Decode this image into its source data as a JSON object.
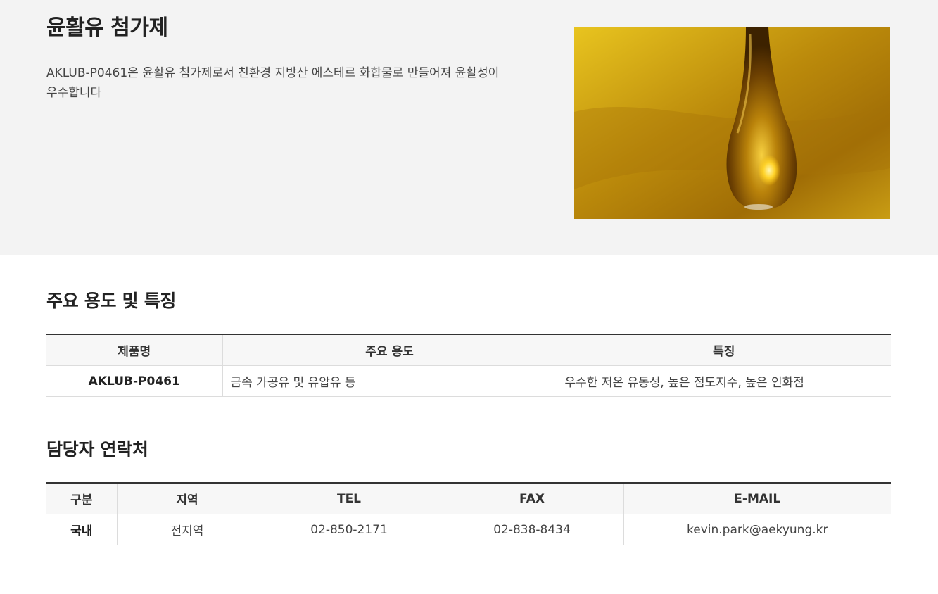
{
  "hero": {
    "title": "윤활유 첨가제",
    "description": "AKLUB-P0461은 윤활유 첨가제로서 친환경 지방산 에스테르 화합물로 만들어져 윤활성이 우수합니다"
  },
  "uses_section": {
    "title": "주요 용도 및 특징",
    "headers": [
      "제품명",
      "주요 용도",
      "특징"
    ],
    "rows": [
      {
        "product": "AKLUB-P0461",
        "use": "금속 가공유 및 유압유 등",
        "feature": "우수한 저온 유동성, 높은 점도지수, 높은 인화점"
      }
    ]
  },
  "contact_section": {
    "title": "담당자 연락처",
    "headers": [
      "구분",
      "지역",
      "TEL",
      "FAX",
      "E-MAIL"
    ],
    "rows": [
      {
        "category": "국내",
        "region": "전지역",
        "tel": "02-850-2171",
        "fax": "02-838-8434",
        "email": "kevin.park@aekyung.kr"
      }
    ]
  },
  "colors": {
    "table_border_top": "#333333",
    "header_bg": "#f7f7f7",
    "hero_bg": "#f3f3f3",
    "oil_gold": "#c79a0f"
  }
}
